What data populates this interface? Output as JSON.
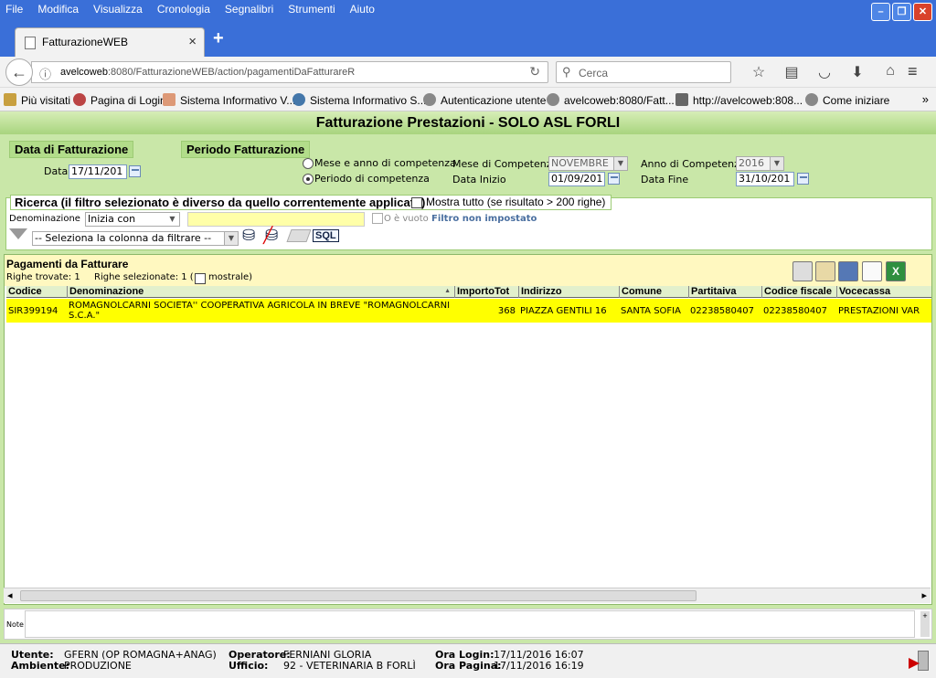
{
  "menu": [
    "File",
    "Modifica",
    "Visualizza",
    "Cronologia",
    "Segnalibri",
    "Strumenti",
    "Aiuto"
  ],
  "tab": {
    "title": "FatturazioneWEB"
  },
  "nav": {
    "url_host": "avelcoweb",
    "url_rest": ":8080/FatturazioneWEB/action/pagamentiDaFatturareR",
    "search_placeholder": "Cerca"
  },
  "bookmarks": [
    "Più visitati",
    "Pagina di Login",
    "Sistema Informativo V...",
    "Sistema Informativo S...",
    "Autenticazione utente",
    "avelcoweb:8080/Fatt...",
    "http://avelcoweb:808...",
    "Come iniziare"
  ],
  "app": {
    "title": "Fatturazione Prestazioni - SOLO ASL FORLI"
  },
  "data_fatt": {
    "legend": "Data di Fatturazione",
    "label": "Data",
    "value": "17/11/201"
  },
  "periodo": {
    "legend": "Periodo Fatturazione",
    "opt1": "Mese e anno di competenza",
    "opt2": "Periodo di competenza",
    "mese_label": "Mese di Competenza",
    "mese_value": "NOVEMBRE",
    "anno_label": "Anno di Competenza",
    "anno_value": "2016",
    "inizio_label": "Data Inizio",
    "inizio_value": "01/09/201",
    "fine_label": "Data Fine",
    "fine_value": "31/10/201"
  },
  "ricerca": {
    "legend": "Ricerca (il filtro selezionato è diverso da quello correntemente applicato)",
    "mostra": "Mostra tutto (se risultato > 200 righe)",
    "denom_label": "Denominazione",
    "match": "Inizia con",
    "vuoto": "O è vuoto",
    "filtro": "Filtro non impostato",
    "colonna": "-- Seleziona la colonna da filtrare --",
    "sql": "SQL"
  },
  "results": {
    "title": "Pagamenti da Fatturare",
    "trovate": "Righe trovate: 1",
    "selezionate": "Righe selezionate: 1 (",
    "mostrale": "mostrale)"
  },
  "columns": [
    "Codice",
    "Denominazione",
    "ImportoTot",
    "Indirizzo",
    "Comune",
    "Partitaiva",
    "Codice fiscale",
    "Vocecassa"
  ],
  "rows": [
    {
      "codice": "SIR399194",
      "denominazione": "ROMAGNOLCARNI SOCIETA'' COOPERATIVA AGRICOLA IN BREVE \"ROMAGNOLCARNI S.C.A.\"",
      "importo": "368",
      "indirizzo": "PIAZZA GENTILI 16",
      "comune": "SANTA SOFIA",
      "piva": "02238580407",
      "cf": "02238580407",
      "voce": "PRESTAZIONI VAR"
    }
  ],
  "notes_label": "Note",
  "status": {
    "utente_l": "Utente:",
    "utente": "GFERN (OP ROMAGNA+ANAG)",
    "ambiente_l": "Ambiente:",
    "ambiente": "PRODUZIONE",
    "operatore_l": "Operatore:",
    "operatore": "FERNIANI GLORIA",
    "ufficio_l": "Ufficio:",
    "ufficio": "92 - VETERINARIA B FORLÌ",
    "login_l": "Ora Login:",
    "login": "17/11/2016 16:07",
    "pagina_l": "Ora Pagina:",
    "pagina": "17/11/2016 16:19"
  }
}
